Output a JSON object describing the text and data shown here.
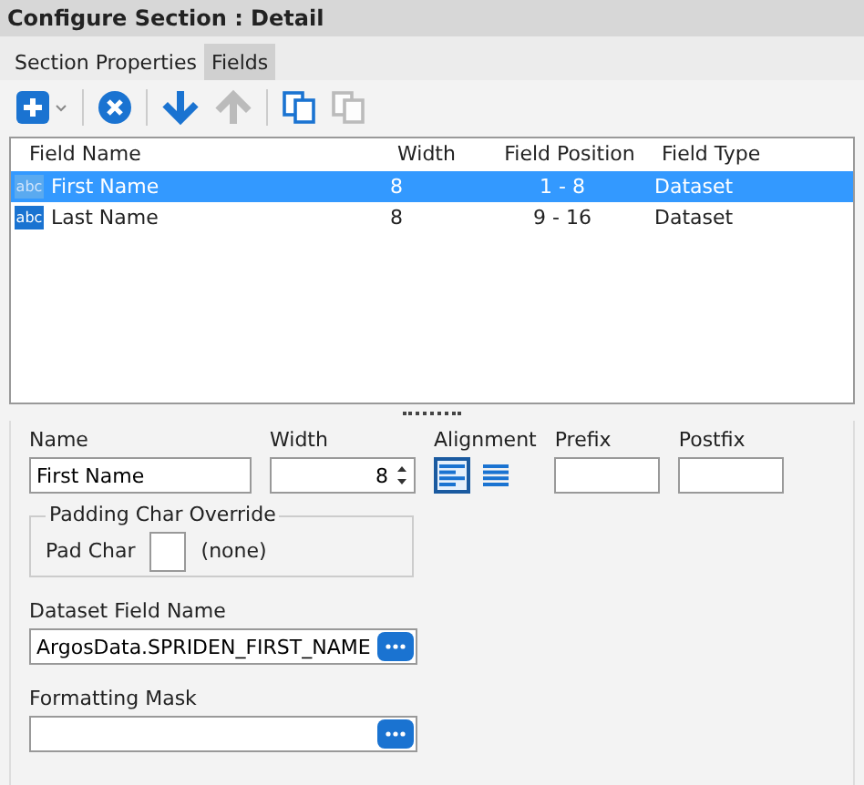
{
  "window": {
    "title": "Configure Section : Detail"
  },
  "tabs": [
    {
      "label": "Section Properties",
      "selected": false
    },
    {
      "label": "Fields",
      "selected": true
    }
  ],
  "toolbar": [
    {
      "kind": "add",
      "disabled": false
    },
    {
      "kind": "remove",
      "disabled": false
    },
    {
      "kind": "down",
      "disabled": false
    },
    {
      "kind": "up",
      "disabled": true
    },
    {
      "kind": "copy",
      "disabled": false
    },
    {
      "kind": "paste",
      "disabled": true
    }
  ],
  "table": {
    "columns": [
      "Field Name",
      "Width",
      "Field Position",
      "Field Type"
    ],
    "rows": [
      {
        "type_badge": "abc",
        "cells": [
          "First Name",
          "8",
          "1 - 8",
          "Dataset"
        ],
        "selected": true
      },
      {
        "type_badge": "abc",
        "cells": [
          "Last Name",
          "8",
          "9 - 16",
          "Dataset"
        ],
        "selected": false
      }
    ]
  },
  "form": {
    "name": {
      "label": "Name",
      "value": "First Name"
    },
    "width": {
      "label": "Width",
      "value": "8"
    },
    "alignment": {
      "label": "Alignment",
      "options": [
        {
          "kind": "left",
          "selected": true
        },
        {
          "kind": "justify",
          "selected": false
        }
      ]
    },
    "prefix": {
      "label": "Prefix"
    },
    "postfix": {
      "label": "Postfix"
    },
    "padding": {
      "title": "Padding Char Override",
      "label": "Pad Char",
      "note": "(none)"
    },
    "dataset_field": {
      "label": "Dataset Field Name",
      "value": "ArgosData.SPRIDEN_FIRST_NAME"
    },
    "formatting_mask": {
      "label": "Formatting Mask"
    }
  }
}
